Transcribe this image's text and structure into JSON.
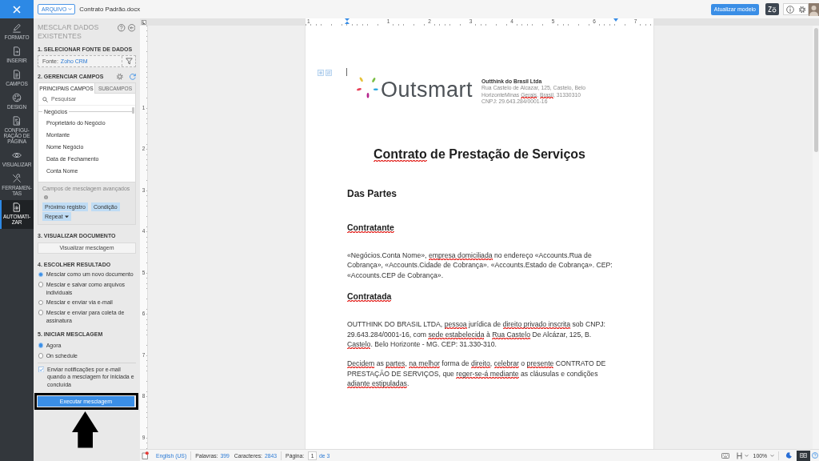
{
  "top_bar": {
    "file_menu": "ARQUIVO",
    "document_title": "Contrato Padrão.docx",
    "update_button": "Atualizar modelo"
  },
  "rail": [
    {
      "label": "FORMATO",
      "kind": "format",
      "selected": false
    },
    {
      "label": "INSERIR",
      "kind": "insert",
      "selected": false
    },
    {
      "label": "CAMPOS",
      "kind": "fields",
      "selected": false
    },
    {
      "label": "DESIGN",
      "kind": "design",
      "selected": false
    },
    {
      "label": "CONFIGU-RAÇÃO DE PÁGINA",
      "kind": "page",
      "selected": false
    },
    {
      "label": "VISUALIZAR",
      "kind": "view",
      "selected": false
    },
    {
      "label": "FERRAMEN-TAS",
      "kind": "tools",
      "selected": false
    },
    {
      "label": "AUTOMATI-ZAR",
      "kind": "automate",
      "selected": true
    }
  ],
  "panel": {
    "title": "MESCLAR DADOS EXISTENTES",
    "source": {
      "heading": "1. SELECIONAR FONTE DE DADOS",
      "label": "Fonte:",
      "value": "Zoho CRM"
    },
    "fields": {
      "heading": "2. GERENCIAR CAMPOS",
      "tabs": [
        {
          "label": "PRINCIPAIS CAMPOS",
          "selected": true
        },
        {
          "label": "SUBCAMPOS",
          "selected": false
        }
      ],
      "search_placeholder": "Pesquisar",
      "group": "Negócios",
      "items": [
        "Proprietário do Negócio",
        "Montante",
        "Nome Negócio",
        "Data de Fechamento",
        "Conta Nome"
      ]
    },
    "advanced": {
      "title": "Campos de mesclagem avançados",
      "chips": [
        {
          "label": "Próximo registro",
          "dropdown": false
        },
        {
          "label": "Condição",
          "dropdown": false
        },
        {
          "label": "Repeat",
          "dropdown": true
        }
      ]
    },
    "preview": {
      "heading": "3. VISUALIZAR DOCUMENTO",
      "button": "Visualizar mesclagem"
    },
    "result": {
      "heading": "4. ESCOLHER RESULTADO",
      "options": [
        {
          "label": "Mesclar como um novo documento",
          "selected": true
        },
        {
          "label": "Mesclar e salvar como arquivos individuais",
          "selected": false
        },
        {
          "label": "Mesclar e enviar via e-mail",
          "selected": false
        },
        {
          "label": "Mesclar e enviar para coleta de assinatura",
          "selected": false
        }
      ]
    },
    "start": {
      "heading": "5. INICIAR MESCLAGEM",
      "options": [
        {
          "label": "Agora",
          "selected": true
        },
        {
          "label": "On schedule",
          "selected": false
        }
      ],
      "notify": {
        "label": "Enviar notificações por e-mail quando a mesclagem for iniciada e concluída",
        "checked": true
      }
    },
    "run_button": "Executar mesclagem"
  },
  "rulers": {
    "horizontal": [
      "1",
      "1",
      "2",
      "3",
      "4",
      "5",
      "6",
      "7"
    ],
    "vertical": [
      "1",
      "2",
      "3",
      "4",
      "5",
      "6",
      "7",
      "8",
      "9"
    ]
  },
  "document": {
    "header": {
      "logo_text": "Outsmart",
      "company": "Outthink do Brasil Ltda",
      "address": [
        {
          "text": "Rua Castelo de Alcazar, 125, Castelo, Belo HorizonteMinas ",
          "misspelled": false
        },
        {
          "text": "Gerais",
          "misspelled": true
        },
        {
          "text": ", ",
          "misspelled": false
        },
        {
          "text": "Brasil",
          "misspelled": true
        },
        {
          "text": ", 31330310",
          "misspelled": false
        }
      ],
      "cnpj": "CNPJ: 29.643.284/0001-16"
    },
    "title": [
      {
        "text": "Contrato",
        "misspelled": true
      },
      {
        "text": " de Prestação de Serviços",
        "misspelled": false
      }
    ],
    "blocks": [
      {
        "kind": "h1",
        "runs": [
          {
            "text": "Das Partes",
            "misspelled": false
          }
        ]
      },
      {
        "kind": "h2",
        "runs": [
          {
            "text": "Contratante",
            "misspelled": true
          }
        ]
      },
      {
        "kind": "p",
        "runs": [
          {
            "text": "«Negócios.Conta Nome», ",
            "misspelled": false
          },
          {
            "text": "empresa domiciliada",
            "misspelled": true
          },
          {
            "text": " no endereço «Accounts.Rua de Cobrança», «Accounts.Cidade de Cobrança». «Accounts.Estado de Cobrança». CEP: «Accounts.CEP de Cobrança».",
            "misspelled": false
          }
        ]
      },
      {
        "kind": "h2",
        "runs": [
          {
            "text": "Contratada",
            "misspelled": true
          }
        ]
      },
      {
        "kind": "p",
        "runs": [
          {
            "text": "OUTTHINK DO BRASIL LTDA, ",
            "misspelled": false
          },
          {
            "text": "pessoa",
            "misspelled": true
          },
          {
            "text": " jurídica de ",
            "misspelled": false
          },
          {
            "text": "direito privado inscrita",
            "misspelled": true
          },
          {
            "text": " sob CNPJ: 29.643.284/0001-16, com ",
            "misspelled": false
          },
          {
            "text": "sede estabelecida",
            "misspelled": true
          },
          {
            "text": " à ",
            "misspelled": false
          },
          {
            "text": "Rua Castelo",
            "misspelled": true
          },
          {
            "text": " De Alcázar, 125, B. ",
            "misspelled": false
          },
          {
            "text": "Castelo",
            "misspelled": true
          },
          {
            "text": ". Belo Horizonte - MG. CEP: 31.330-310.",
            "misspelled": false
          }
        ]
      },
      {
        "kind": "p",
        "runs": [
          {
            "text": "Decidem",
            "misspelled": true
          },
          {
            "text": " as ",
            "misspelled": false
          },
          {
            "text": "partes",
            "misspelled": true
          },
          {
            "text": ", ",
            "misspelled": false
          },
          {
            "text": "na melhor",
            "misspelled": true
          },
          {
            "text": " forma de ",
            "misspelled": false
          },
          {
            "text": "direito",
            "misspelled": true
          },
          {
            "text": ", ",
            "misspelled": false
          },
          {
            "text": "celebrar",
            "misspelled": true
          },
          {
            "text": " o ",
            "misspelled": false
          },
          {
            "text": "presente",
            "misspelled": true
          },
          {
            "text": " CONTRATO DE PRESTAÇÃO DE SERVIÇOS, que ",
            "misspelled": false
          },
          {
            "text": "reger-se-á mediante",
            "misspelled": true
          },
          {
            "text": " as cláusulas e condições ",
            "misspelled": false
          },
          {
            "text": "adiante estipuladas",
            "misspelled": true
          },
          {
            "text": ".",
            "misspelled": false
          }
        ]
      }
    ]
  },
  "status_bar": {
    "alert": true,
    "language": "English (US)",
    "words_label": "Palavras:",
    "words": "399",
    "chars_label": "Caracteres:",
    "chars": "2843",
    "page_label": "Página:",
    "page": "1",
    "page_total": "de 3",
    "zoom": "100%",
    "view_modes": [
      {
        "kind": "night",
        "selected": false
      },
      {
        "kind": "reading",
        "selected": true
      }
    ]
  }
}
